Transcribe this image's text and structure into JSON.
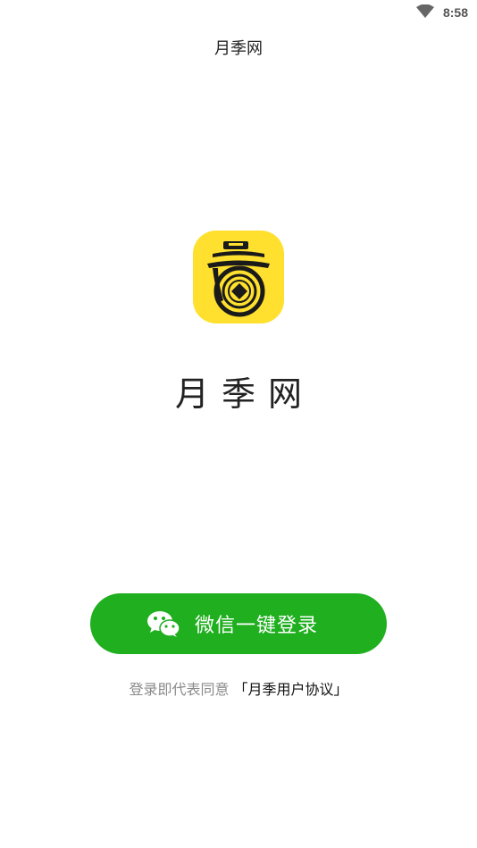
{
  "status_bar": {
    "time": "8:58",
    "wifi_icon": "wifi-icon"
  },
  "header": {
    "title": "月季网"
  },
  "app": {
    "name": "月季网",
    "logo_icon": "app-logo-icon",
    "logo_bg_color": "#ffe02e"
  },
  "login": {
    "wechat_button_label": "微信一键登录",
    "wechat_icon": "wechat-icon",
    "button_color": "#1faf1f"
  },
  "agreement": {
    "prefix": "登录即代表同意",
    "link_text": "「月季用户协议」"
  }
}
